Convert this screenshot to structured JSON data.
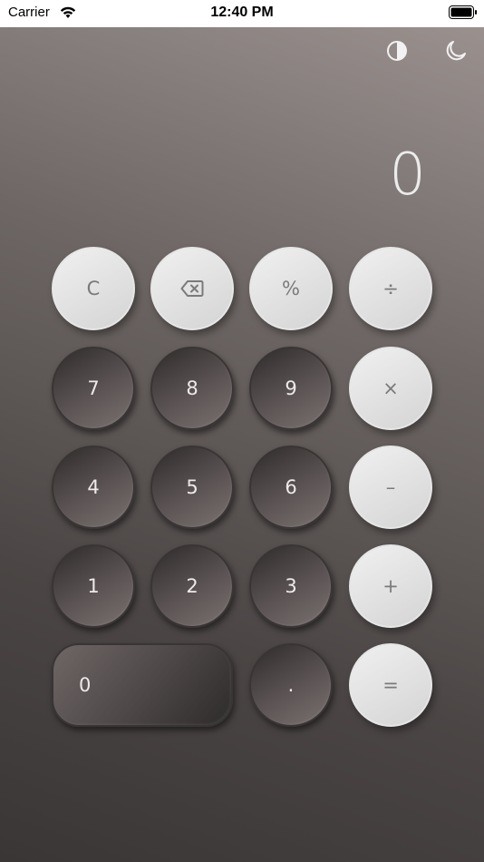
{
  "status_bar": {
    "carrier": "Carrier",
    "time": "12:40 PM",
    "wifi_icon": "wifi-icon",
    "battery_icon": "battery-icon"
  },
  "toolbar": {
    "contrast_icon": "contrast-icon",
    "theme_icon": "moon-icon"
  },
  "display": {
    "value": "0"
  },
  "keys": {
    "clear": "C",
    "backspace_icon": "backspace-icon",
    "percent": "%",
    "divide": "÷",
    "seven": "7",
    "eight": "8",
    "nine": "9",
    "multiply": "×",
    "four": "4",
    "five": "5",
    "six": "6",
    "minus": "–",
    "one": "1",
    "two": "2",
    "three": "3",
    "plus": "+",
    "zero": "0",
    "decimal": ".",
    "equals": "="
  },
  "colors": {
    "light_key": "#dcdcdc",
    "dark_key": "#4a4444",
    "background_top": "#9a918f",
    "background_bottom": "#3a3636"
  }
}
